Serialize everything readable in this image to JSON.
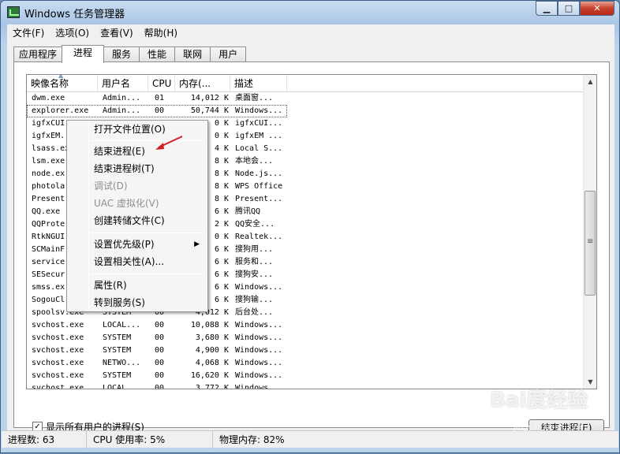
{
  "window": {
    "title": "Windows 任务管理器",
    "btn_min": "▁",
    "btn_max": "□",
    "btn_close": "✕"
  },
  "menu": [
    "文件(F)",
    "选项(O)",
    "查看(V)",
    "帮助(H)"
  ],
  "tabs": [
    "应用程序",
    "进程",
    "服务",
    "性能",
    "联网",
    "用户"
  ],
  "active_tab": "进程",
  "columns": [
    "映像名称",
    "用户名",
    "CPU",
    "内存(...",
    "描述"
  ],
  "rows": [
    [
      "dwm.exe",
      "Admin...",
      "01",
      "14,012 K",
      "桌面窗..."
    ],
    [
      "explorer.exe",
      "Admin...",
      "00",
      "50,744 K",
      "Windows..."
    ],
    [
      "igfxCUI",
      "",
      "",
      "0 K",
      "igfxCUI..."
    ],
    [
      "igfxEM.",
      "",
      "",
      "0 K",
      "igfxEM ..."
    ],
    [
      "lsass.ex",
      "",
      "",
      "4 K",
      "Local S..."
    ],
    [
      "lsm.exe",
      "",
      "",
      "8 K",
      "本地会..."
    ],
    [
      "node.ex",
      "",
      "",
      "8 K",
      "Node.js..."
    ],
    [
      "photola",
      "",
      "",
      "8 K",
      "WPS Office"
    ],
    [
      "Present",
      "",
      "",
      "8 K",
      "Present..."
    ],
    [
      "QQ.exe",
      "",
      "",
      "6 K",
      "腾讯QQ"
    ],
    [
      "QQProte",
      "",
      "",
      "2 K",
      "QQ安全..."
    ],
    [
      "RtkNGUI",
      "",
      "",
      "0 K",
      "Realtek..."
    ],
    [
      "SCMainF",
      "",
      "",
      "6 K",
      "搜狗用..."
    ],
    [
      "service",
      "",
      "",
      "6 K",
      "服务和..."
    ],
    [
      "SESecur",
      "",
      "",
      "6 K",
      "搜狗安..."
    ],
    [
      "smss.ex",
      "",
      "",
      "6 K",
      "Windows..."
    ],
    [
      "SogouCl",
      "",
      "",
      "6 K",
      "搜狗输..."
    ],
    [
      "spoolsv.exe",
      "SYSTEM",
      "00",
      "4,012 K",
      "后台处..."
    ],
    [
      "svchost.exe",
      "LOCAL...",
      "00",
      "10,088 K",
      "Windows..."
    ],
    [
      "svchost.exe",
      "SYSTEM",
      "00",
      "3,680 K",
      "Windows..."
    ],
    [
      "svchost.exe",
      "SYSTEM",
      "00",
      "4,900 K",
      "Windows..."
    ],
    [
      "svchost.exe",
      "NETWO...",
      "00",
      "4,068 K",
      "Windows..."
    ],
    [
      "svchost.exe",
      "SYSTEM",
      "00",
      "16,620 K",
      "Windows..."
    ],
    [
      "svchost.exe",
      "LOCAL",
      "00",
      "3,772 K",
      "Windows..."
    ]
  ],
  "selected_row": "explorer.exe",
  "context_menu": {
    "open_location": "打开文件位置(O)",
    "end_process": "结束进程(E)",
    "end_tree": "结束进程树(T)",
    "debug": "调试(D)",
    "uac_virt": "UAC 虚拟化(V)",
    "create_dump": "创建转储文件(C)",
    "set_priority": "设置优先级(P)",
    "set_affinity": "设置相关性(A)...",
    "properties": "属性(R)",
    "goto_service": "转到服务(S)",
    "submenu_arrow": "▶"
  },
  "show_all_label": "显示所有用户的进程(S)",
  "show_all_checked": "✓",
  "end_button": "结束进程(E)",
  "status": {
    "processes": "进程数: 63",
    "cpu": "CPU 使用率: 5%",
    "memory": "物理内存: 82%"
  },
  "scrollbar": {
    "up": "▲",
    "down": "▼"
  },
  "annotation_color": "#d02020",
  "watermark": {
    "text": "Bai度经验",
    "url": "jingyan.baidu.com"
  }
}
